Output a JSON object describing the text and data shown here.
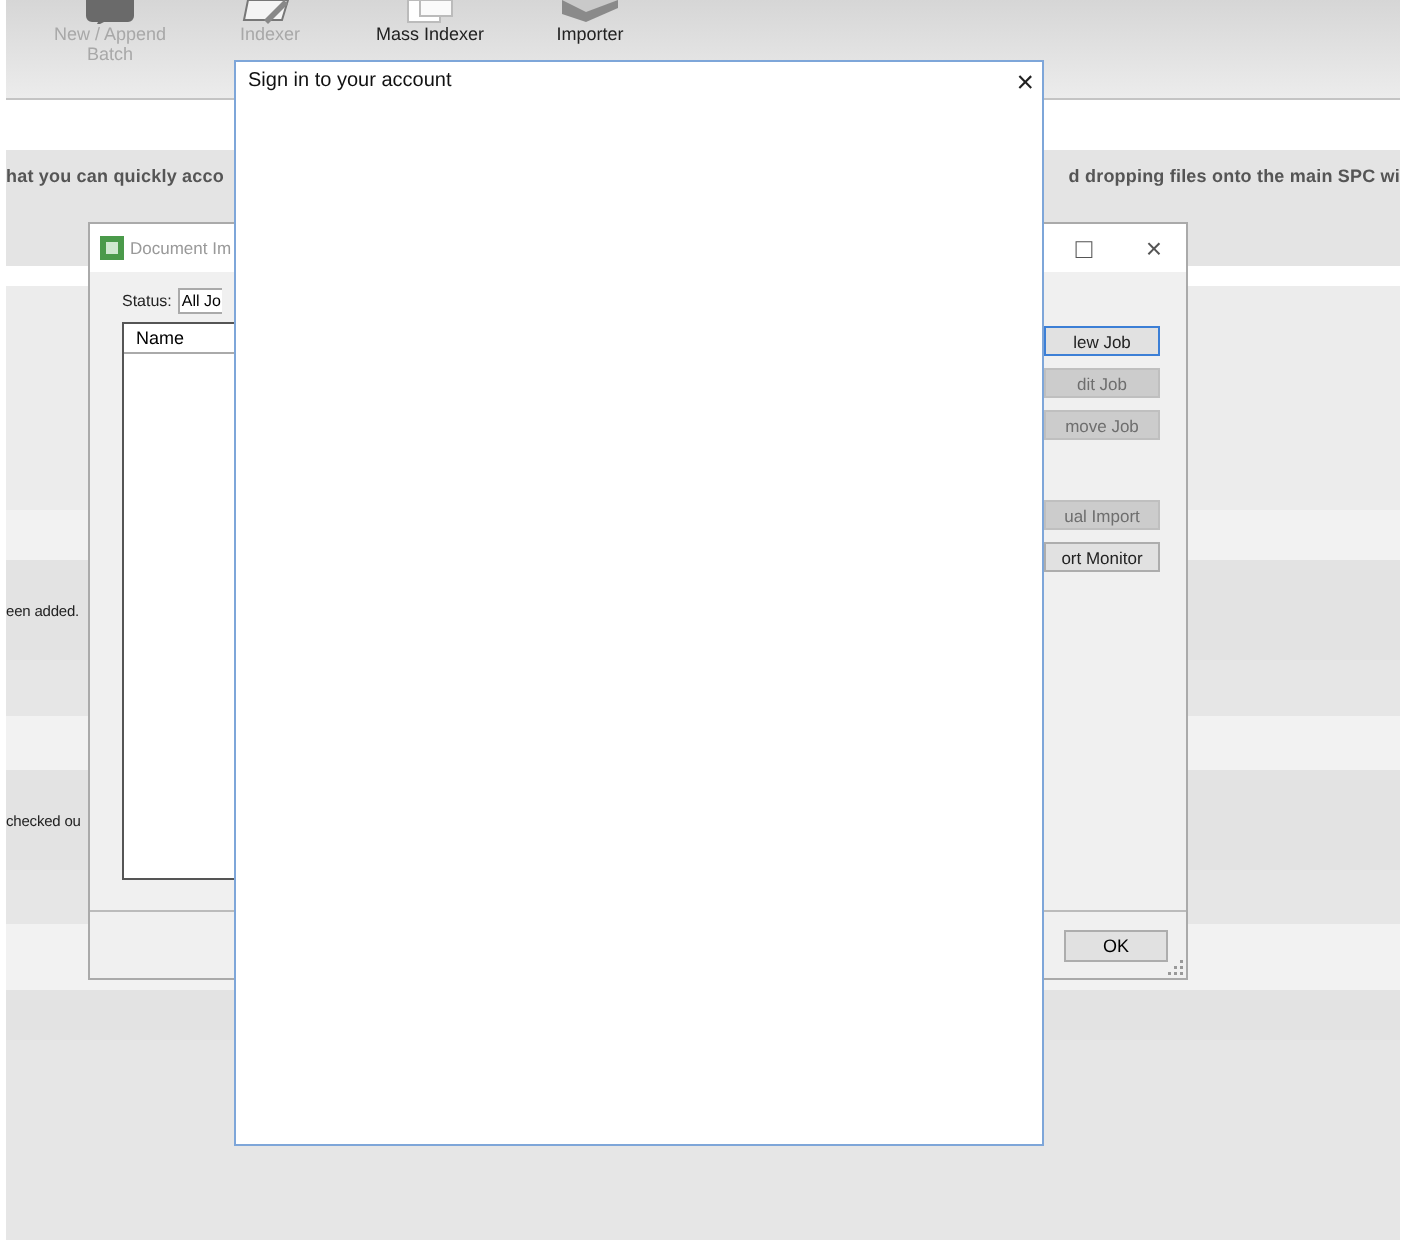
{
  "app": {
    "toolbar": [
      {
        "label": "New / Append Batch",
        "disabled": true
      },
      {
        "label": "Indexer",
        "disabled": true
      },
      {
        "label": "Mass Indexer",
        "disabled": false
      },
      {
        "label": "Importer",
        "disabled": false
      }
    ],
    "banner": {
      "left": "hat you can quickly acco",
      "right": "d dropping files onto the main SPC wi"
    },
    "messages": [
      "een added.",
      "checked ou"
    ]
  },
  "import_dialog": {
    "title": "Document Im",
    "maximize": "□",
    "close": "×",
    "status_label": "Status:",
    "status_value": "All Jo",
    "list_header": "Name",
    "button_groups": [
      [
        {
          "label": "lew Job",
          "disabled": false,
          "focused": true
        },
        {
          "label": "dit Job",
          "disabled": true,
          "focused": false
        },
        {
          "label": "move Job",
          "disabled": true,
          "focused": false
        }
      ],
      [
        {
          "label": "ual Import",
          "disabled": true,
          "focused": false
        },
        {
          "label": "ort Monitor",
          "disabled": false,
          "focused": false
        }
      ]
    ],
    "ok": "OK"
  },
  "sign_in_dialog": {
    "title": "Sign in to your account",
    "close": "×"
  }
}
